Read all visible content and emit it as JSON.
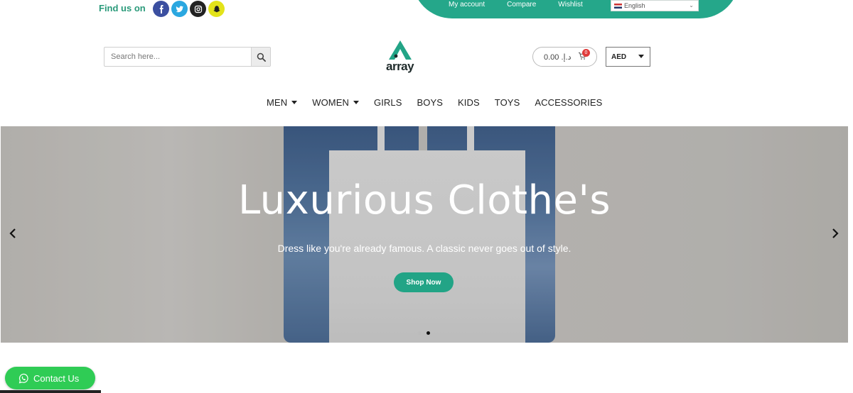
{
  "topbar": {
    "find_us_label": "Find us on",
    "social_icons": [
      "facebook-icon",
      "twitter-icon",
      "instagram-icon",
      "snapchat-icon"
    ],
    "links": [
      "My account",
      "Compare",
      "Wishlist"
    ],
    "language": "English",
    "band_color": "#25a78a"
  },
  "header": {
    "search_placeholder": "Search here...",
    "logo_text": "array",
    "cart_amount": "0.00 .د.إ",
    "cart_count": "0",
    "currency": "AED"
  },
  "nav": {
    "items": [
      {
        "label": "MEN",
        "dropdown": true
      },
      {
        "label": "WOMEN",
        "dropdown": true
      },
      {
        "label": "GIRLS",
        "dropdown": false
      },
      {
        "label": "BOYS",
        "dropdown": false
      },
      {
        "label": "KIDS",
        "dropdown": false
      },
      {
        "label": "TOYS",
        "dropdown": false
      },
      {
        "label": "ACCESSORIES",
        "dropdown": false
      }
    ]
  },
  "hero": {
    "title": "Luxurious Clothe's",
    "subtitle": "Dress like you're already famous. A classic never goes out of style.",
    "button_label": "Shop Now",
    "active_slide": 2,
    "slide_count": 2,
    "accent_color": "#22a486"
  },
  "floating": {
    "contact_label": "Contact Us",
    "contact_color": "#2fcc55"
  }
}
